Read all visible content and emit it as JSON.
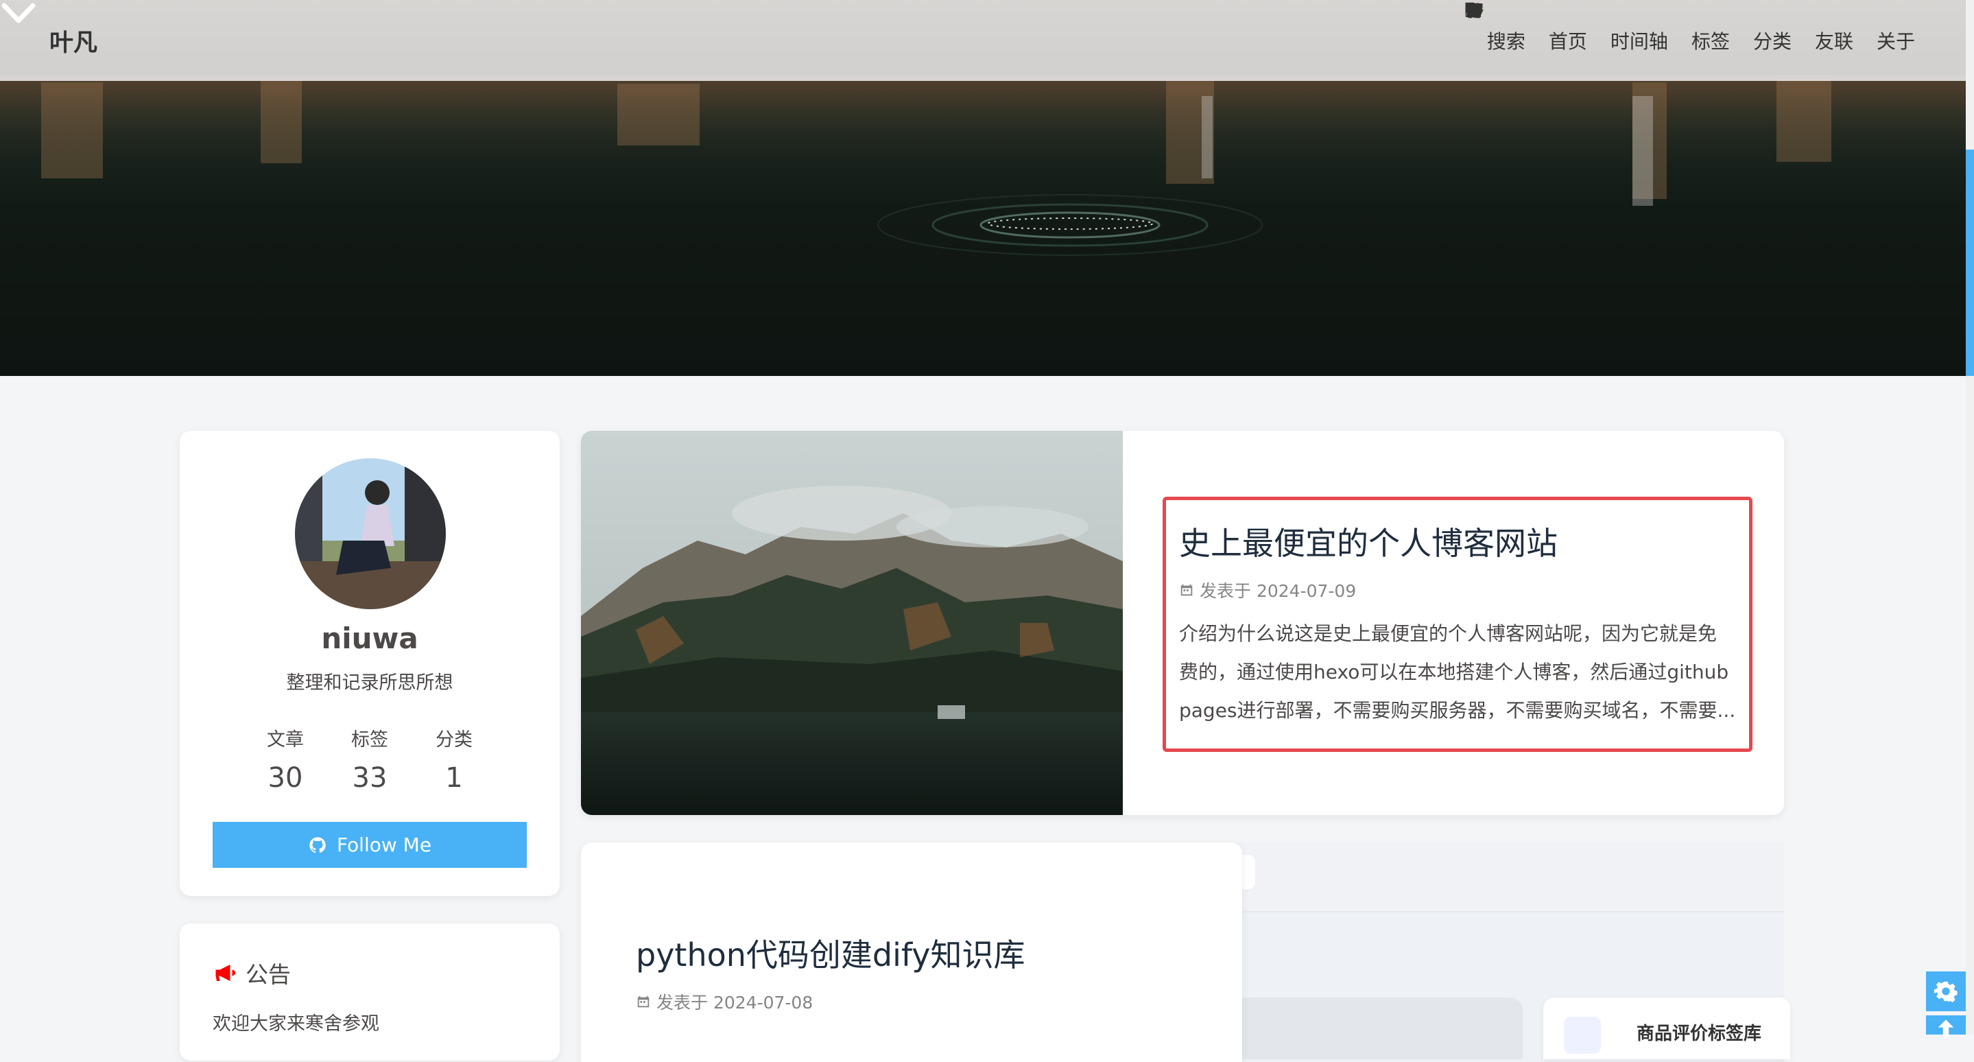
{
  "site": {
    "title": "叶凡"
  },
  "nav": {
    "items": [
      {
        "label": "搜索",
        "icon": "search-icon"
      },
      {
        "label": "首页",
        "icon": "home-icon"
      },
      {
        "label": "时间轴",
        "icon": "archive-icon"
      },
      {
        "label": "标签",
        "icon": "tags-icon"
      },
      {
        "label": "分类",
        "icon": "folder-open-icon"
      },
      {
        "label": "友联",
        "icon": "link-icon"
      },
      {
        "label": "关于",
        "icon": "heart-icon"
      }
    ]
  },
  "profile": {
    "name": "niuwa",
    "description": "整理和记录所思所想",
    "stats": [
      {
        "label": "文章",
        "value": "30"
      },
      {
        "label": "标签",
        "value": "33"
      },
      {
        "label": "分类",
        "value": "1"
      }
    ],
    "follow_label": "Follow Me"
  },
  "announcement": {
    "title": "公告",
    "text": "欢迎大家来寒舍参观"
  },
  "posts": [
    {
      "title": "史上最便宜的个人博客网站",
      "meta": "发表于 2024-07-09",
      "excerpt_lines": [
        "介绍为什么说这是史上最便宜的个人博客网站呢，因为它就是免",
        "费的，通过使用hexo可以在本地搭建个人博客，然后通过github",
        "pages进行部署，不需要购买服务器，不需要购买域名，不需要..."
      ]
    },
    {
      "title": "python代码创建dify知识库",
      "meta": "发表于 2024-07-08"
    }
  ],
  "background_card": {
    "title": "商品评价标签库"
  },
  "colors": {
    "accent": "#49b1f5",
    "highlight_border": "#e5484d",
    "announcement_icon": "#ff0000"
  }
}
